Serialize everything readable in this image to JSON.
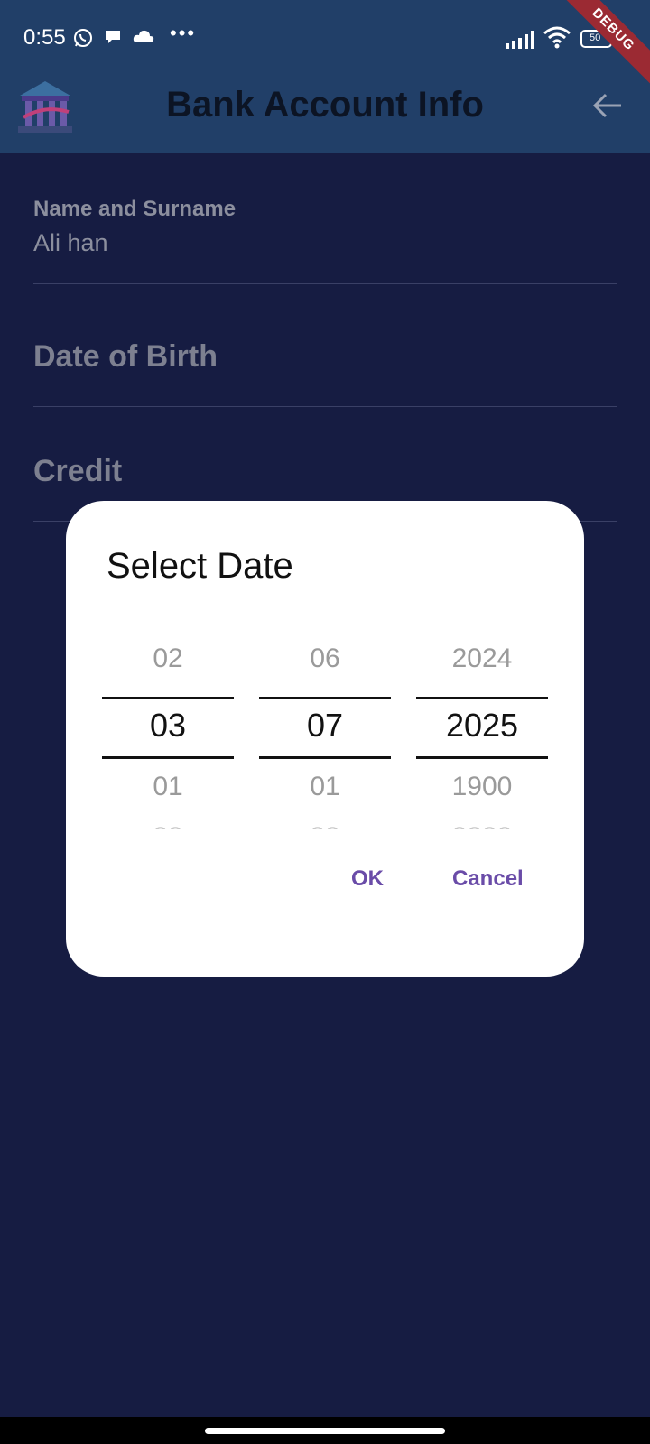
{
  "status_bar": {
    "time": "0:55",
    "more": "•••",
    "battery": "50",
    "debug_banner": "DEBUG"
  },
  "app_bar": {
    "title": "Bank Account Info"
  },
  "form": {
    "name_label": "Name and Surname",
    "name_value": "Ali han",
    "dob_label": "Date of Birth",
    "credit_label": "Credit"
  },
  "dialog": {
    "title": "Select Date",
    "day": {
      "prev": "02",
      "selected": "03",
      "next": "01"
    },
    "month": {
      "prev": "06",
      "selected": "07",
      "next": "01"
    },
    "year": {
      "prev": "2024",
      "selected": "2025",
      "next": "1900"
    },
    "ok_label": "OK",
    "cancel_label": "Cancel"
  },
  "colors": {
    "background": "#161c42",
    "app_bar": "#213f68",
    "accent": "#6a4ca8"
  }
}
